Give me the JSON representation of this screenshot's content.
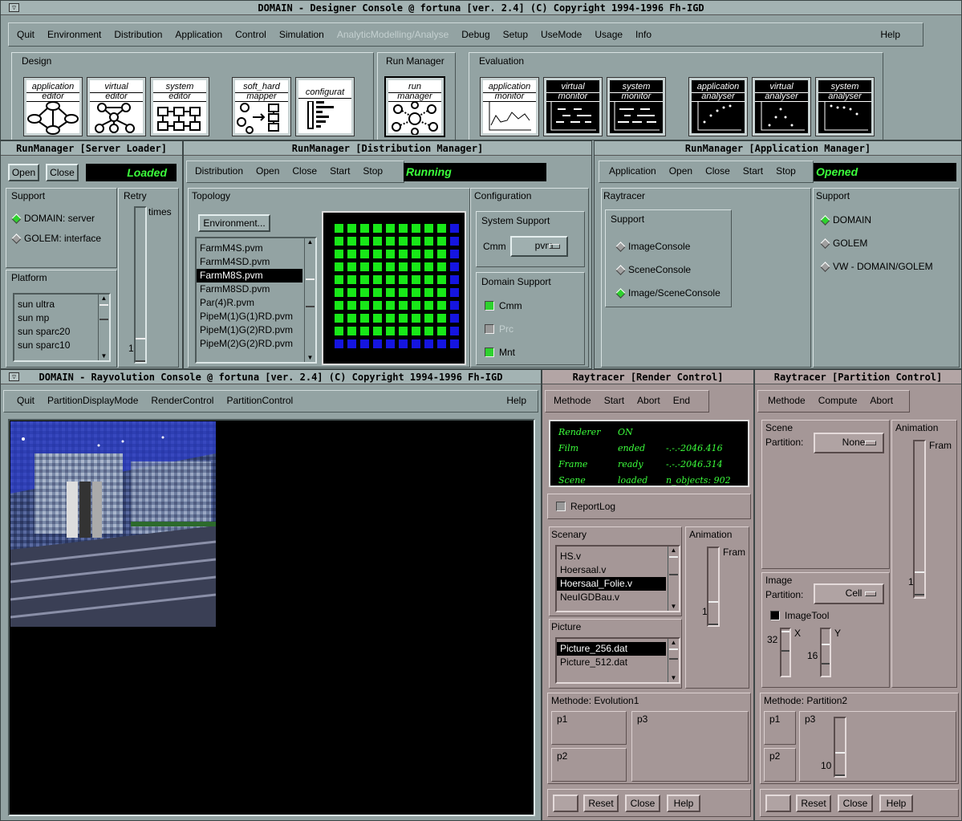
{
  "designer": {
    "title": "DOMAIN - Designer Console @ fortuna  [ver. 2.4]  (C) Copyright 1994-1996  Fh-IGD",
    "menu": [
      "Quit",
      "Environment",
      "Distribution",
      "Application",
      "Control",
      "Simulation",
      "AnalyticModelling/Analyse",
      "Debug",
      "Setup",
      "UseMode",
      "Usage",
      "Info"
    ],
    "help": "Help",
    "groups": {
      "design": "Design",
      "run": "Run Manager",
      "eval": "Evaluation"
    },
    "tools": [
      {
        "l1": "application",
        "l2": "editor"
      },
      {
        "l1": "virtual",
        "l2": "editor"
      },
      {
        "l1": "system",
        "l2": "editor"
      },
      {
        "l1": "soft_hard",
        "l2": "mapper"
      },
      {
        "l1": "configurat",
        "l2": ""
      },
      {
        "l1": "run",
        "l2": "manager"
      },
      {
        "l1": "application",
        "l2": "monitor"
      },
      {
        "l1": "virtual",
        "l2": "monitor"
      },
      {
        "l1": "system",
        "l2": "monitor"
      },
      {
        "l1": "application",
        "l2": "analyser"
      },
      {
        "l1": "virtual",
        "l2": "analyser"
      },
      {
        "l1": "system",
        "l2": "analyser"
      }
    ]
  },
  "server_loader": {
    "title": "RunManager [Server Loader]",
    "open": "Open",
    "close": "Close",
    "status": "Loaded",
    "support": "Support",
    "support_items": [
      "DOMAIN: server",
      "GOLEM:  interface"
    ],
    "retry": "Retry",
    "times": "times",
    "retry_value": "1",
    "platform": "Platform",
    "platforms": [
      "sun ultra",
      "sun mp",
      "sun sparc20",
      "sun sparc10"
    ]
  },
  "dist_manager": {
    "title": "RunManager [Distribution Manager]",
    "menu": [
      "Distribution",
      "Open",
      "Close",
      "Start",
      "Stop"
    ],
    "status": "Running",
    "topology": "Topology",
    "env_button": "Environment...",
    "files": [
      "FarmM4S.pvm",
      "FarmM4SD.pvm",
      "FarmM8S.pvm",
      "FarmM8SD.pvm",
      "Par(4)R.pvm",
      "PipeM(1)G(1)RD.pvm",
      "PipeM(1)G(2)RD.pvm",
      "PipeM(2)G(2)RD.pvm"
    ],
    "selected_file": 2,
    "configuration": "Configuration",
    "system_support": "System Support",
    "cmm_label": "Cmm",
    "cmm_value": "pvm",
    "domain_support": "Domain Support",
    "checks": [
      "Cmm",
      "Prc",
      "Mnt"
    ],
    "grid_colors": {
      "node": "#18e818",
      "last": "#1515e0"
    }
  },
  "app_manager": {
    "title": "RunManager [Application Manager]",
    "menu": [
      "Application",
      "Open",
      "Close",
      "Start",
      "Stop"
    ],
    "status": "Opened",
    "raytracer": "Raytracer",
    "support": "Support",
    "items": [
      "ImageConsole",
      "SceneConsole",
      "Image/SceneConsole"
    ],
    "support2": "Support",
    "items2": [
      "DOMAIN",
      "GOLEM",
      "VW - DOMAIN/GOLEM"
    ]
  },
  "rayvolution": {
    "title": "DOMAIN - Rayvolution Console @ fortuna [ver. 2.4]  (C) Copyright 1994-1996  Fh-IGD",
    "menu": [
      "Quit",
      "PartitionDisplayMode",
      "RenderControl",
      "PartitionControl"
    ],
    "help": "Help"
  },
  "render_control": {
    "title": "Raytracer [Render Control]",
    "menu": [
      "Methode",
      "Start",
      "Abort",
      "End"
    ],
    "status_rows": [
      [
        "Renderer",
        "ON",
        ""
      ],
      [
        "Film",
        "ended",
        "-.-.-2046.416"
      ],
      [
        "Frame",
        "ready",
        "-.-.-2046.314"
      ],
      [
        "Scene",
        "loaded",
        "n_objects: 902"
      ]
    ],
    "reportlog": "ReportLog",
    "scenary": "Scenary",
    "scenes": [
      "HS.v",
      "Hoersaal.v",
      "Hoersaal_Folie.v",
      "NeuIGDBau.v"
    ],
    "selected_scene": 2,
    "animation": "Animation",
    "fram": "Fram",
    "anim_value": "1",
    "picture": "Picture",
    "pictures": [
      "Picture_256.dat",
      "Picture_512.dat"
    ],
    "selected_picture": 0,
    "methode": "Methode: Evolution1",
    "p1": "p1",
    "p2": "p2",
    "p3": "p3",
    "buttons": [
      "Reset",
      "Close",
      "Help"
    ]
  },
  "partition_control": {
    "title": "Raytracer [Partition Control]",
    "menu": [
      "Methode",
      "Compute",
      "Abort"
    ],
    "scene": "Scene",
    "partition": "Partition:",
    "scene_partition": "None",
    "animation": "Animation",
    "fram": "Fram",
    "anim_value": "1",
    "image": "Image",
    "image_partition": "Cell",
    "imagetool": "ImageTool",
    "x_label": "X",
    "y_label": "Y",
    "x_value": "32",
    "y_value": "16",
    "methode": "Methode: Partition2",
    "p1": "p1",
    "p2": "p2",
    "p3": "p3",
    "p3_value": "10",
    "buttons": [
      "Reset",
      "Close",
      "Help"
    ]
  }
}
